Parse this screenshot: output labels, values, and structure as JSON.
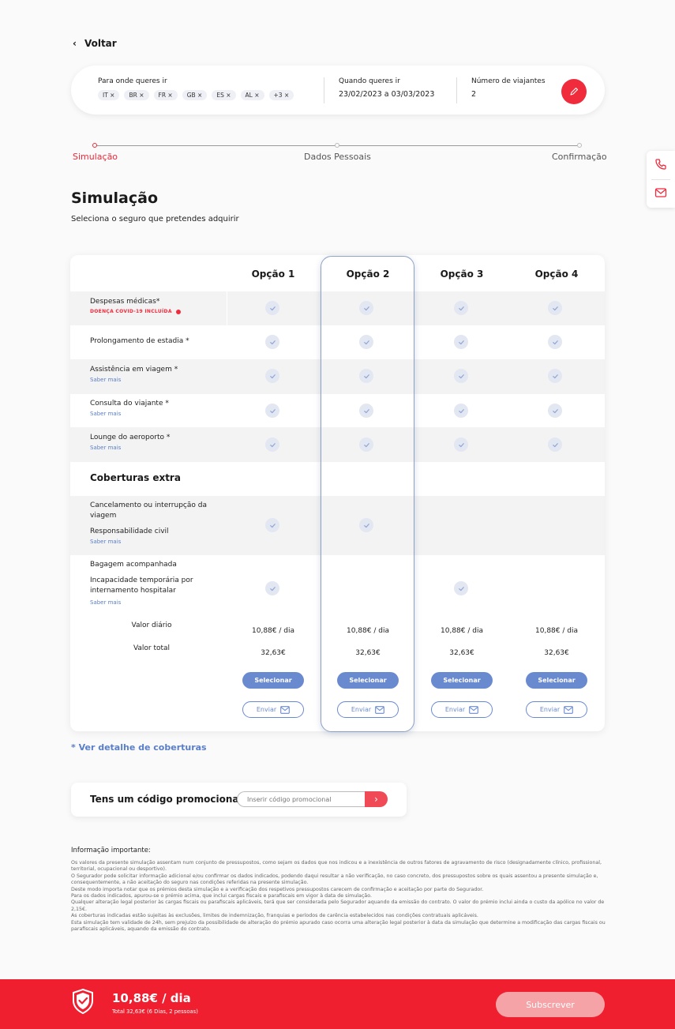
{
  "back_label": "Voltar",
  "search": {
    "destination_label": "Para onde queres ir",
    "chips": [
      "IT ×",
      "BR ×",
      "FR ×",
      "GB ×",
      "ES ×",
      "AL ×",
      "+3 ×"
    ],
    "when_label": "Quando queres ir",
    "when_value": "23/02/2023 a 03/03/2023",
    "travelers_label": "Número de viajantes",
    "travelers_value": "2",
    "edit_icon": "pencil-icon"
  },
  "stepper": {
    "steps": [
      "Simulação",
      "Dados Pessoais",
      "Confirmação"
    ],
    "active_index": 0
  },
  "contact": {
    "icons": [
      "phone-icon",
      "mail-icon"
    ]
  },
  "page": {
    "title": "Simulação",
    "subtitle": "Seleciona o seguro que pretendes adquirir"
  },
  "table": {
    "options": [
      "Opção 1",
      "Opção 2",
      "Opção 3",
      "Opção 4"
    ],
    "highlighted_option": 1,
    "rows": [
      {
        "label": "Despesas médicas*",
        "tag": "DOENÇA COVID-19 INCLUÍDA",
        "checks": [
          true,
          true,
          true,
          true
        ]
      },
      {
        "label": "Prolongamento de estadia *",
        "checks": [
          true,
          true,
          true,
          true
        ]
      },
      {
        "label": "Assistência em viagem *",
        "link": "Saber mais",
        "checks": [
          true,
          true,
          true,
          true
        ]
      },
      {
        "label": "Consulta do viajante *",
        "link": "Saber mais",
        "checks": [
          true,
          true,
          true,
          true
        ]
      },
      {
        "label": "Lounge do aeroporto *",
        "link": "Saber mais",
        "checks": [
          true,
          true,
          true,
          true
        ]
      }
    ],
    "extra_title": "Coberturas extra",
    "extra_rows": [
      {
        "label1": "Cancelamento ou interrupção da viagem",
        "label2": "Responsabilidade civil",
        "link": "Saber mais",
        "checks": [
          true,
          true,
          false,
          false
        ]
      },
      {
        "label1": "Bagagem acompanhada",
        "label2": "Incapacidade temporária por internamento hospitalar",
        "link": "Saber mais",
        "checks": [
          true,
          false,
          true,
          false
        ]
      }
    ],
    "daily_label": "Valor diário",
    "total_label": "Valor total",
    "daily_values": [
      "10,88€ / dia",
      "10,88€ / dia",
      "10,88€ / dia",
      "10,88€ / dia"
    ],
    "total_values": [
      "32,63€",
      "32,63€",
      "32,63€",
      "32,63€"
    ],
    "select_label": "Selecionar",
    "send_label": "Enviar"
  },
  "detail_link": "* Ver detalhe de coberturas",
  "promo": {
    "label": "Tens um código promocional?",
    "placeholder": "Inserir código promocional"
  },
  "info": {
    "title": "Informação importante:",
    "lines": [
      "Os valores da presente simulação assentam num conjunto de pressupostos, como sejam os dados que nos indicou e a inexistência de outros fatores de agravamento de risco (designadamente clínico, profissional, territorial, ocupacional ou desportivo).",
      "O Segurador pode solicitar informação adicional e/ou confirmar os dados indicados, podendo daqui resultar a não verificação, no caso concreto, dos pressupostos sobre os quais assentou a presente simulação e, consequentemente, a não aceitação do seguro nas condições referidas na presente simulação.",
      "Deste modo importa notar que os prémios desta simulação e a verificação dos respetivos pressupostos carecem de confirmação  e aceitação por parte do Segurador.",
      "Para os dados indicados, apurou-se o prémio acima, que inclui cargas fiscais e parafiscais em vigor à data de simulação.",
      "Qualquer alteração legal posterior às cargas fiscais ou parafiscais aplicáveis, terá que ser considerada pelo Segurador aquando da emissão do contrato. O valor do prémio inclui ainda o custo da apólice no valor de 2,15€.",
      "As coberturas indicadas estão sujeitas às exclusões, limites de indemnização, franquias e períodos de carência estabelecidos nas condições contratuais aplicáveis.",
      "Esta simulação tem validade de 24h, sem prejuízo da possibilidade de alteração do prémio apurado caso ocorra uma alteração legal posterior à data da simulação que determine a modificação das cargas fiscais ou parafiscais aplicáveis, aquando da emissão do contrato."
    ]
  },
  "footer": {
    "price": "10,88€ / dia",
    "total": "Total 32,63€   (6 Dias, 2 pessoas)",
    "subscribe_label": "Subscrever",
    "shield_icon": "shield-check-icon"
  },
  "colors": {
    "brand_red": "#ef1f2f",
    "accent_blue": "#6a8ad0",
    "check_bg": "#e2e7f2"
  }
}
